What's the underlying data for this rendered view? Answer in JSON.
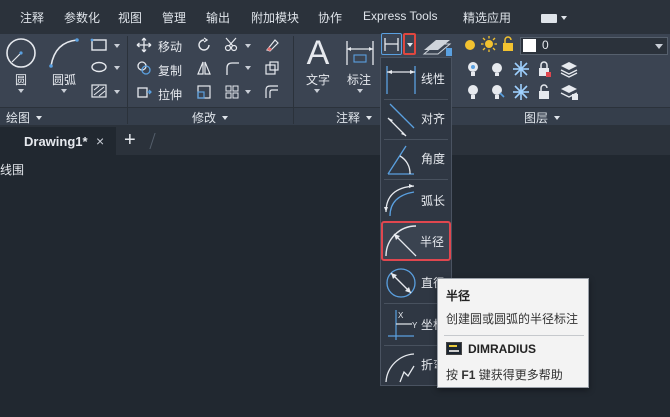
{
  "menubar": {
    "items": [
      "注释",
      "参数化",
      "视图",
      "管理",
      "输出",
      "附加模块",
      "协作",
      "Express Tools",
      "精选应用"
    ]
  },
  "ribbon": {
    "draw": {
      "circle_label": "圆",
      "arc_label": "圆弧",
      "panel_label": "绘图"
    },
    "modify": {
      "move_label": "移动",
      "copy_label": "复制",
      "stretch_label": "拉伸",
      "panel_label": "修改"
    },
    "annotation": {
      "text_label": "文字",
      "dimension_label": "标注",
      "panel_label": "注释"
    },
    "layers": {
      "current_layer": "0",
      "panel_label": "图层",
      "current_layer_color": "#ffffff"
    }
  },
  "tabs": {
    "document": "Drawing1*",
    "close": "×",
    "new": "+"
  },
  "viewport": {
    "label": "线围"
  },
  "flyout": {
    "items": [
      "线性",
      "对齐",
      "角度",
      "弧长",
      "半径",
      "直径",
      "坐标",
      "折弯"
    ],
    "active": "半径"
  },
  "tooltip": {
    "title": "半径",
    "description": "创建圆或圆弧的半径标注",
    "command": "DIMRADIUS",
    "help_prefix": "按",
    "help_key": "F1",
    "help_suffix": "键获得更多帮助"
  },
  "colors": {
    "background": "#212830",
    "menubar": "#2b323b",
    "ribbon": "#3b4452",
    "highlight_red": "#e0474f",
    "accent_blue": "#5aa0e0"
  }
}
